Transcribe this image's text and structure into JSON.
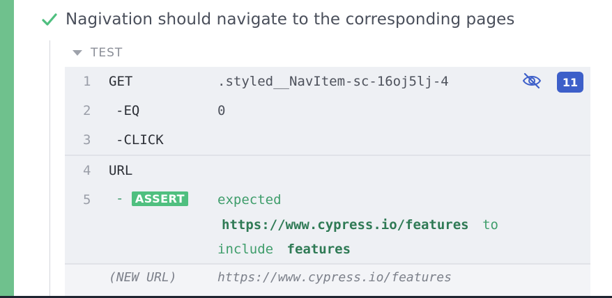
{
  "test": {
    "title": "Nagivation should navigate to the corresponding pages",
    "section_label": "TEST"
  },
  "commands": [
    {
      "num": "1",
      "name": "GET",
      "arg": ".styled__NavItem-sc-16oj5lj-4"
    },
    {
      "num": "2",
      "name": "-EQ",
      "arg": "0"
    },
    {
      "num": "3",
      "name": "-CLICK",
      "arg": ""
    },
    {
      "num": "4",
      "name": "URL",
      "arg": ""
    },
    {
      "num": "5",
      "name": "ASSERT",
      "arg": ""
    }
  ],
  "assert": {
    "dash": "-",
    "badge": "ASSERT",
    "line1": "expected",
    "url": "https://www.cypress.io/features",
    "to": "to",
    "include": "include",
    "value": "features"
  },
  "element_count": "11",
  "new_url": {
    "label": "(NEW URL)",
    "value": "https://www.cypress.io/features"
  },
  "colors": {
    "pass_green": "#6fc18d",
    "badge_blue": "#3d5fc9",
    "assert_green": "#4fbf7f"
  },
  "icons": [
    "check-icon",
    "caret-down-icon",
    "eye-slash-icon"
  ]
}
